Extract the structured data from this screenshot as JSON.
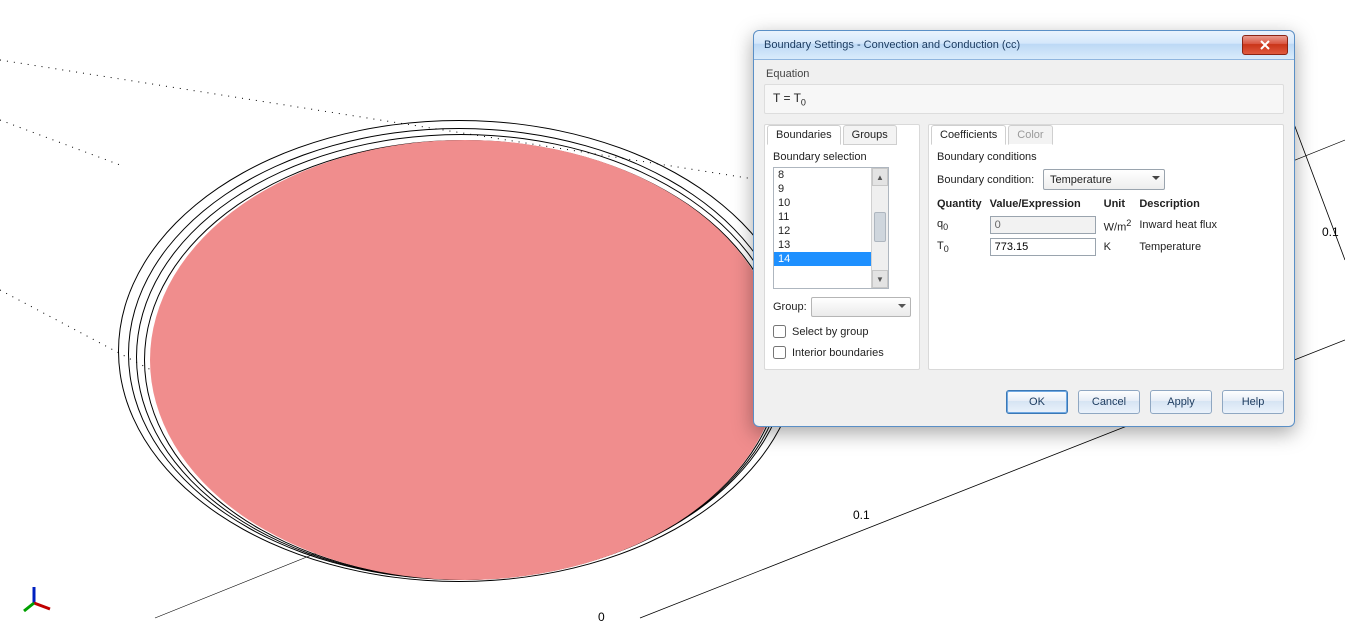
{
  "dialog": {
    "title": "Boundary Settings - Convection and Conduction (cc)",
    "equation_label": "Equation",
    "equation": "T = T",
    "equation_sub": "0",
    "tabs_left": {
      "boundaries": "Boundaries",
      "groups": "Groups"
    },
    "tabs_right": {
      "coefficients": "Coefficients",
      "color": "Color"
    },
    "boundary_selection_label": "Boundary selection",
    "list": [
      "8",
      "9",
      "10",
      "11",
      "12",
      "13",
      "14"
    ],
    "selected": "14",
    "group_label": "Group:",
    "select_by_group": "Select by group",
    "interior": "Interior boundaries",
    "bc_section": "Boundary conditions",
    "bc_label": "Boundary condition:",
    "bc_value": "Temperature",
    "table": {
      "headers": {
        "quantity": "Quantity",
        "value": "Value/Expression",
        "unit": "Unit",
        "desc": "Description"
      },
      "rows": [
        {
          "q": "q",
          "qsub": "0",
          "val": "0",
          "unit": "W/m",
          "unit_sup": "2",
          "desc": "Inward heat flux",
          "disabled": true
        },
        {
          "q": "T",
          "qsub": "0",
          "val": "773.15",
          "unit": "K",
          "unit_sup": "",
          "desc": "Temperature",
          "disabled": false
        }
      ]
    },
    "buttons": {
      "ok": "OK",
      "cancel": "Cancel",
      "apply": "Apply",
      "help": "Help"
    }
  },
  "canvas": {
    "tick_a": "0.1",
    "tick_b": "0",
    "tick_c": "0.1"
  }
}
